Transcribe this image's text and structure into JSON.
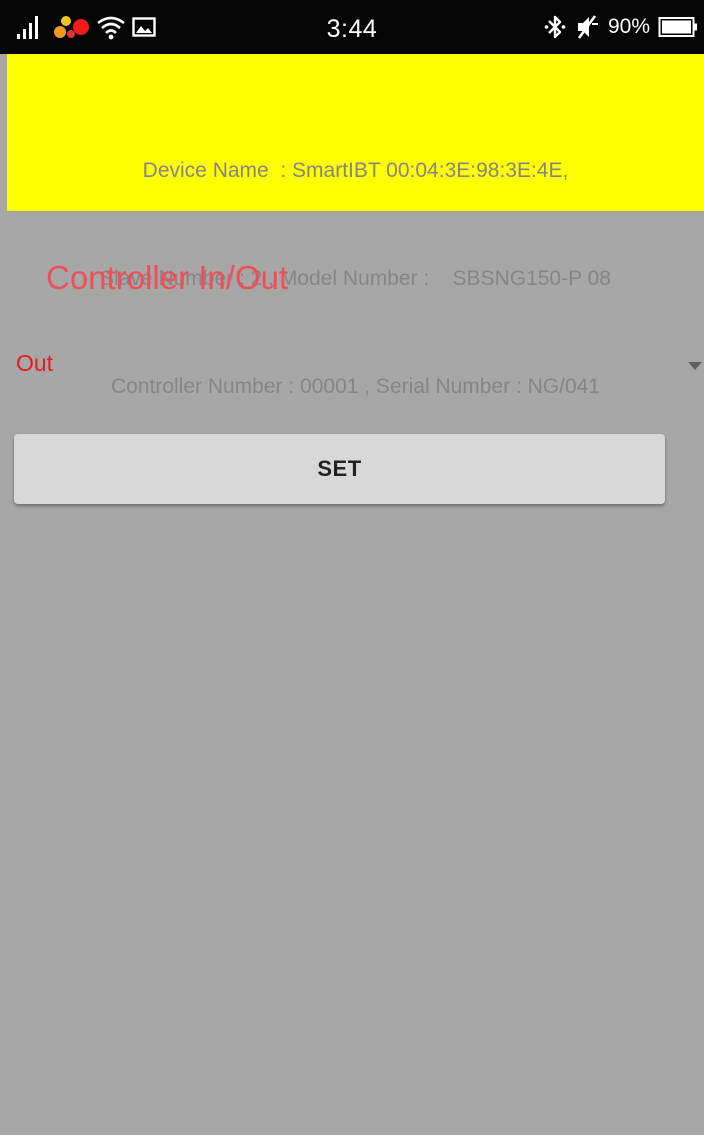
{
  "status_bar": {
    "time": "3:44",
    "battery_percent": "90%",
    "icons": [
      "signal-icon",
      "notification-icon",
      "wifi-icon",
      "image-icon",
      "bluetooth-icon",
      "mute-icon",
      "battery-icon"
    ]
  },
  "device_info": {
    "line1": "Device Name  : SmartIBT 00:04:3E:98:3E:4E,",
    "line2": "Slave Number : 2 , Model Number :    SBSNG150-P 08",
    "line3": "Controller Number : 00001 , Serial Number : NG/041"
  },
  "controller": {
    "title": "Controller In/Out",
    "selected_value": "Out",
    "set_label": "SET"
  },
  "colors": {
    "banner_background": "#ffff00",
    "banner_text": "#858585",
    "screen_background": "#a7a7a7",
    "title_color": "#ef4f58",
    "spinner_value_color": "#e91822",
    "button_background": "#d8d8d8"
  }
}
